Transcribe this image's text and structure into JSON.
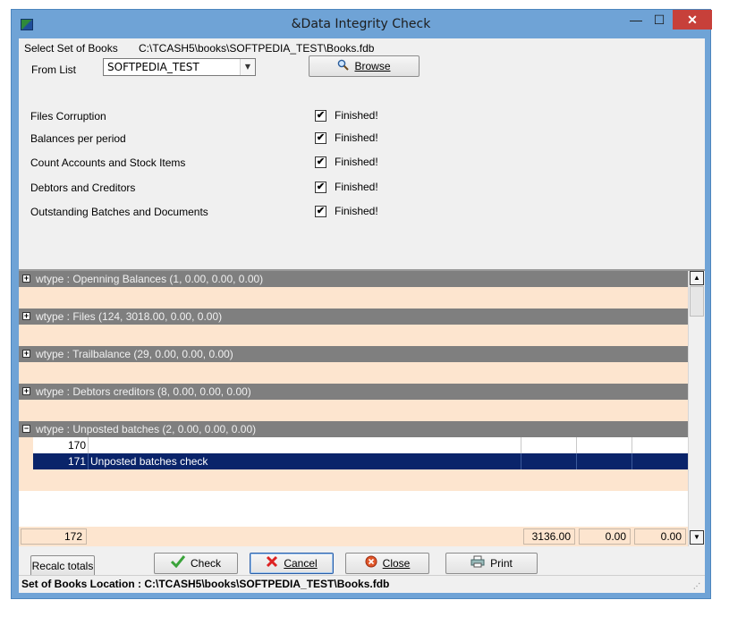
{
  "window": {
    "title": "&Data Integrity Check",
    "min_symbol": "—",
    "max_symbol": "☐",
    "close_symbol": "✕"
  },
  "top": {
    "select_label": "Select Set of Books",
    "path": "C:\\TCASH5\\books\\SOFTPEDIA_TEST\\Books.fdb",
    "from_list_label": "From List",
    "from_list_value": "SOFTPEDIA_TEST",
    "browse_label": "Browse"
  },
  "checks": [
    {
      "name": "Files Corruption",
      "checked": "✔",
      "status": "Finished!"
    },
    {
      "name": "Balances per period",
      "checked": "✔",
      "status": "Finished!"
    },
    {
      "name": "Count Accounts and Stock Items",
      "checked": "✔",
      "status": "Finished!"
    },
    {
      "name": "Debtors and Creditors",
      "checked": "✔",
      "status": "Finished!"
    },
    {
      "name": "Outstanding Batches and Documents",
      "checked": "✔",
      "status": "Finished!"
    }
  ],
  "grid": {
    "groups": [
      {
        "label": "wtype : Openning Balances (1, 0.00, 0.00, 0.00)",
        "toggle": "+"
      },
      {
        "label": "wtype : Files (124, 3018.00, 0.00, 0.00)",
        "toggle": "+"
      },
      {
        "label": "wtype : Trailbalance (29, 0.00, 0.00, 0.00)",
        "toggle": "+"
      },
      {
        "label": "wtype : Debtors creditors (8, 0.00, 0.00, 0.00)",
        "toggle": "+"
      },
      {
        "label": "wtype : Unposted batches (2, 0.00, 0.00, 0.00)",
        "toggle": "−"
      }
    ],
    "rows": [
      {
        "num": "170",
        "text": ""
      },
      {
        "num": "171",
        "text": "Unposted batches check"
      }
    ],
    "footer": {
      "count": "172",
      "total1": "3136.00",
      "total2": "0.00",
      "total3": "0.00"
    },
    "scroll_up": "▲",
    "scroll_down": "▼"
  },
  "buttons": {
    "recalc": "Recalc totals",
    "check": "Check",
    "cancel": "Cancel",
    "close": "Close",
    "print": "Print"
  },
  "status": {
    "label": "Set of Books Location : ",
    "path": "C:\\TCASH5\\books\\SOFTPEDIA_TEST\\Books.fdb"
  },
  "colors": {
    "titlebar": "#6fa3d6",
    "group_header": "#7f7f7f",
    "group_body": "#fde5cf",
    "selected_row": "#0a246a",
    "close_button": "#c7403a"
  }
}
